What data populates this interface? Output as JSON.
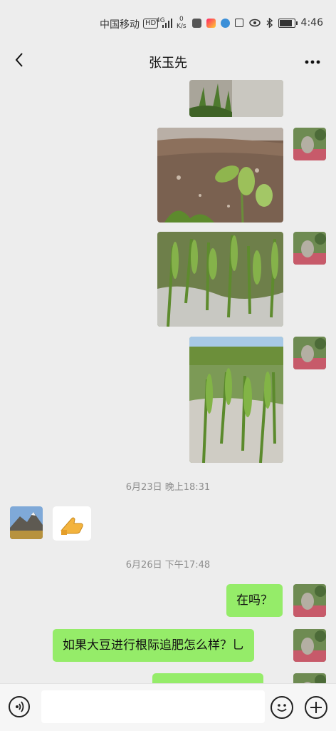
{
  "status_bar": {
    "carrier": "中国移动",
    "hd": "HD",
    "network": "4G",
    "speed_value": "0",
    "speed_unit": "K/s",
    "time": "4:46"
  },
  "header": {
    "title": "张玉先",
    "back_icon": "chevron-left-icon",
    "more_icon": "more-dots-icon"
  },
  "messages": {
    "timestamp_1": "6月23日 晚上18:31",
    "timestamp_2": "6月26日 下午17:48",
    "sticker": "thumbs-up-emoji",
    "text_1": "在吗？",
    "text_2": "如果大豆进行根际追肥怎么样？乚"
  },
  "colors": {
    "background": "#EDEDED",
    "sent_bubble": "#95EC69",
    "received_bubble": "#FFFFFF",
    "timestamp": "#8E8E8E"
  },
  "input_bar": {
    "voice_icon": "voice-icon",
    "emoji_icon": "emoji-icon",
    "plus_icon": "plus-icon"
  }
}
